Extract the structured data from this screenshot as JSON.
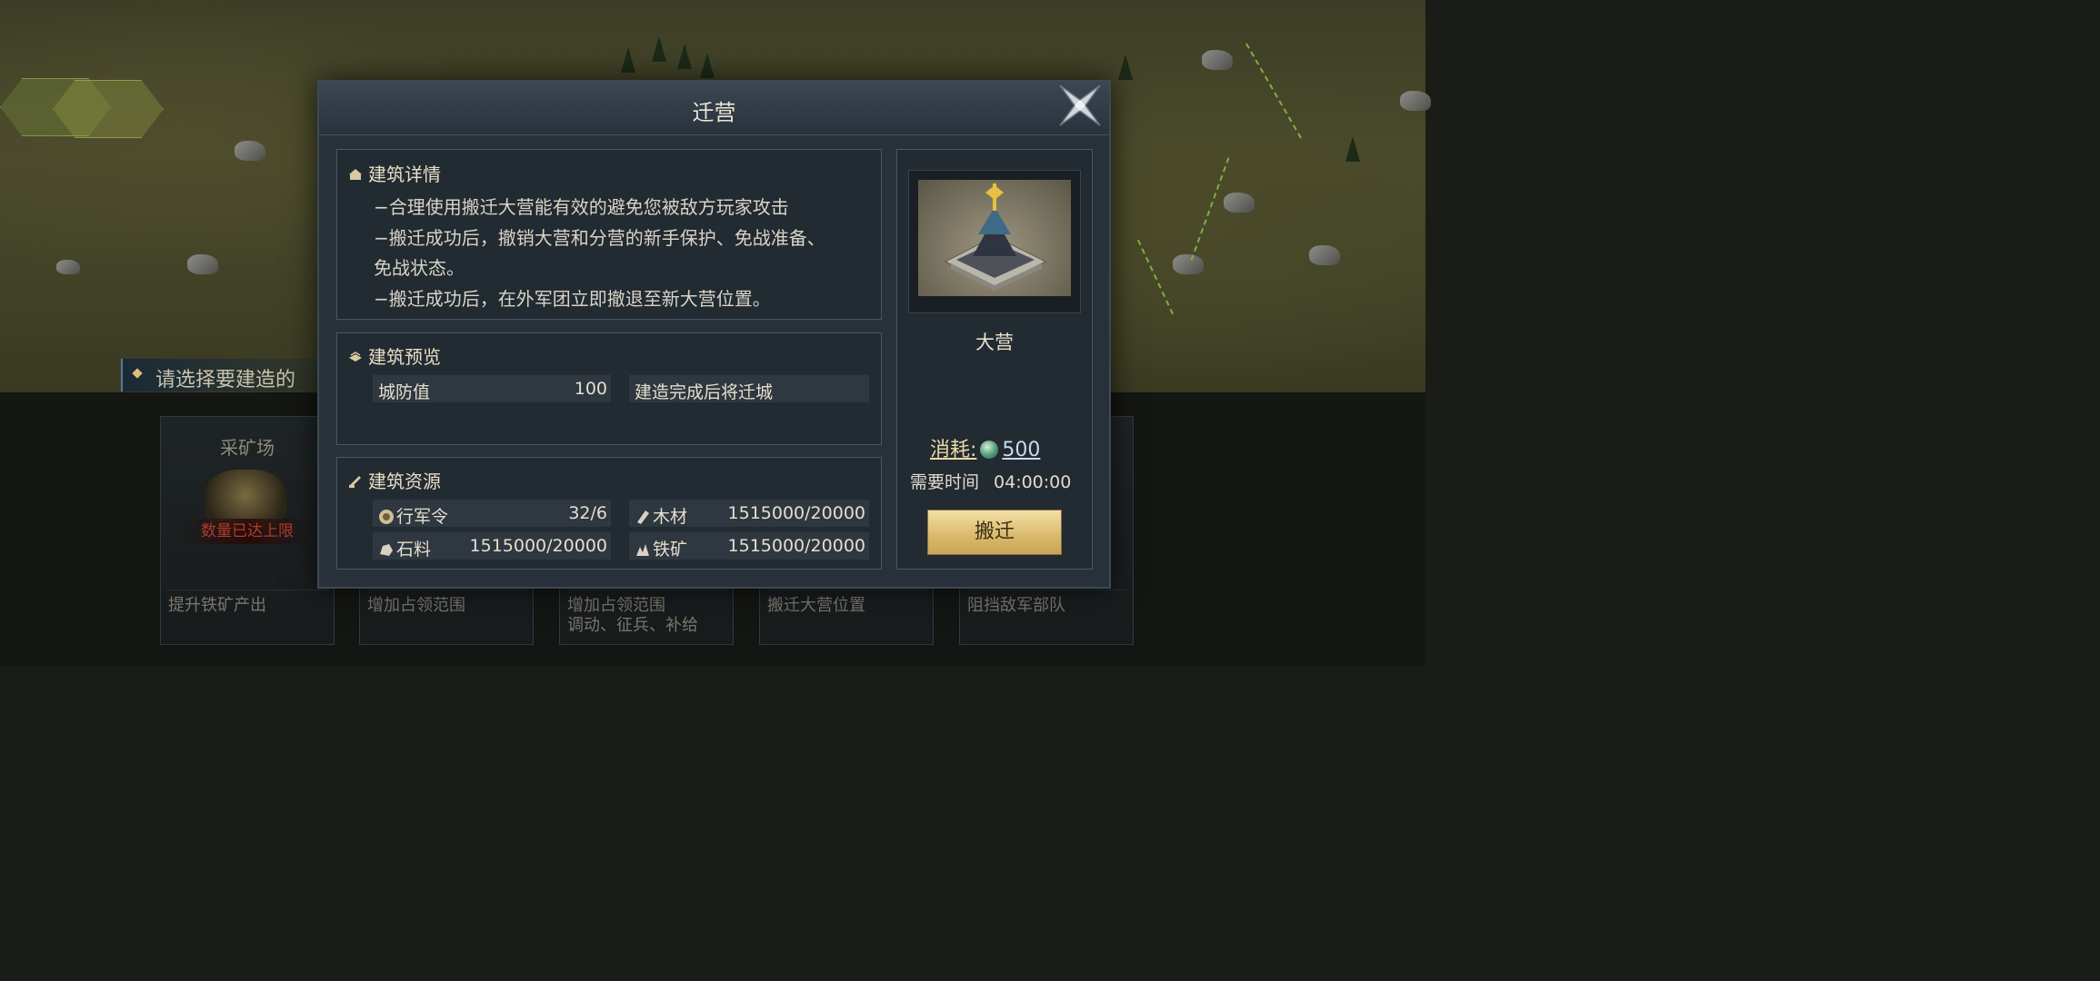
{
  "hint_text": "请选择要建造的",
  "bottom_cards": [
    {
      "name": "采矿场",
      "desc": [
        "提升铁矿产出"
      ],
      "limit": "数量已达上限"
    },
    {
      "name": "",
      "desc": [
        "增加占领范围"
      ],
      "limit": ""
    },
    {
      "name": "",
      "desc": [
        "增加占领范围",
        "调动、征兵、补给"
      ],
      "limit": ""
    },
    {
      "name": "",
      "desc": [
        "搬迁大营位置"
      ],
      "limit": ""
    },
    {
      "name": "",
      "desc": [
        "阻挡敌军部队"
      ],
      "limit": ""
    }
  ],
  "dialog": {
    "title": "迁营",
    "details": {
      "title": "建筑详情",
      "lines": [
        "−合理使用搬迁大营能有效的避免您被敌方玩家攻击",
        "−搬迁成功后，撤销大营和分营的新手保护、免战准备、",
        "免战状态。",
        "−搬迁成功后，在外军团立即撤退至新大营位置。"
      ]
    },
    "preview": {
      "title": "建筑预览",
      "defense_label": "城防值",
      "defense_value": "100",
      "note": "建造完成后将迁城"
    },
    "resources": {
      "title": "建筑资源",
      "items": [
        {
          "label": "行军令",
          "value": "32/6",
          "icon": "march-token-icon"
        },
        {
          "label": "木材",
          "value": "1515000/20000",
          "icon": "wood-icon"
        },
        {
          "label": "石料",
          "value": "1515000/20000",
          "icon": "stone-icon"
        },
        {
          "label": "铁矿",
          "value": "1515000/20000",
          "icon": "iron-icon"
        }
      ]
    },
    "building": {
      "name": "大营",
      "cost_label": "消耗:",
      "cost_amount": "500",
      "cost_icon": "jade-icon",
      "time_label": "需要时间",
      "time_value": "04:00:00",
      "button_label": "搬迁"
    }
  }
}
